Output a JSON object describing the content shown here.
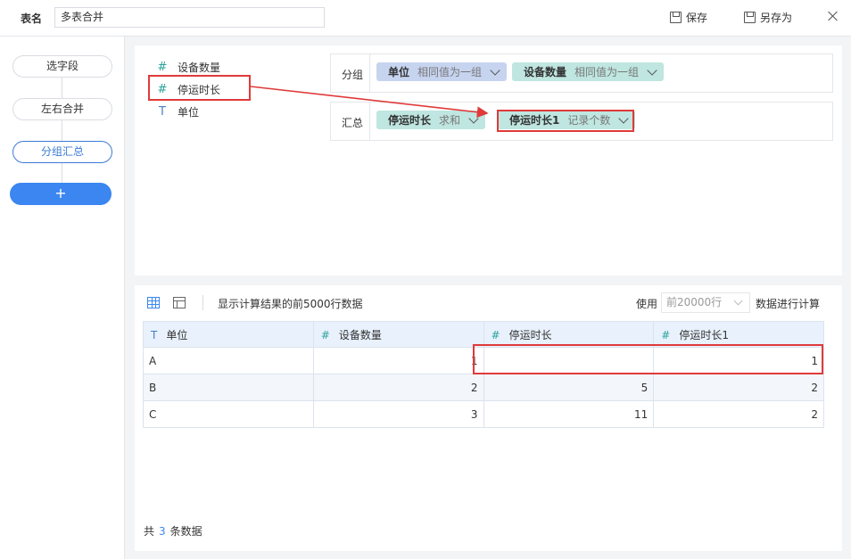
{
  "topbar": {
    "name_label": "表名",
    "table_name": "多表合并",
    "save_label": "保存",
    "save_as_label": "另存为"
  },
  "steps": {
    "select_fields": "选字段",
    "lr_merge": "左右合并",
    "group_summary": "分组汇总",
    "add": "+"
  },
  "fields": [
    {
      "type": "#",
      "name": "设备数量"
    },
    {
      "type": "#",
      "name": "停运时长"
    },
    {
      "type": "T",
      "name": "单位"
    }
  ],
  "group": {
    "label": "分组",
    "pills": [
      {
        "name": "单位",
        "op": "相同值为一组"
      },
      {
        "name": "设备数量",
        "op": "相同值为一组"
      }
    ]
  },
  "summary": {
    "label": "汇总",
    "pills": [
      {
        "name": "停运时长",
        "op": "求和"
      },
      {
        "name": "停运时长1",
        "op": "记录个数"
      }
    ]
  },
  "data_toolbar": {
    "info": "显示计算结果的前5000行数据",
    "use_label": "使用",
    "limit_value": "前20000行",
    "calc_suffix": "数据进行计算"
  },
  "table": {
    "columns": [
      {
        "type": "T",
        "name": "单位"
      },
      {
        "type": "#",
        "name": "设备数量"
      },
      {
        "type": "#",
        "name": "停运时长"
      },
      {
        "type": "#",
        "name": "停运时长1"
      }
    ],
    "rows": [
      [
        "A",
        "1",
        "",
        "1"
      ],
      [
        "B",
        "2",
        "5",
        "2"
      ],
      [
        "C",
        "3",
        "11",
        "2"
      ]
    ]
  },
  "footer": {
    "prefix": "共",
    "count": "3",
    "suffix": "条数据"
  },
  "colors": {
    "accent": "#3b86f0",
    "annotation_red": "#e03a3a",
    "group_pill": "#c7d4f0",
    "summary_pill": "#bfe6e0"
  }
}
